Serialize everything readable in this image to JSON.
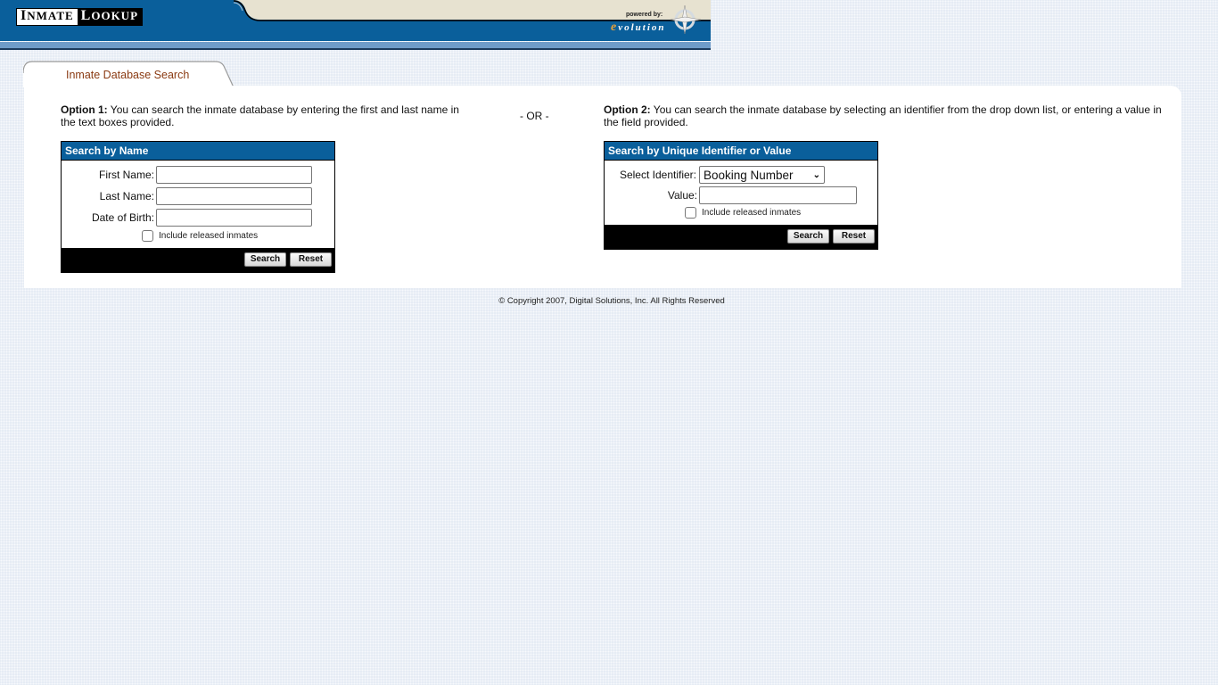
{
  "header": {
    "logo_word1_cap": "I",
    "logo_word1_rest": "NMATE",
    "logo_word2_cap": "L",
    "logo_word2_rest": "OOKUP",
    "powered_by": "powered by:",
    "brand_e": "e",
    "brand_rest": "volution",
    "colors": {
      "banner_blue": "#0a5f9b",
      "banner_beige": "#e7e2d0",
      "stripe_blue": "#6f9cc9"
    }
  },
  "tab": {
    "label": "Inmate Database Search",
    "label_color": "#8a3a12"
  },
  "option1": {
    "prefix": "Option 1:",
    "text": " You can search the inmate database by entering the first and last name in the text boxes provided."
  },
  "separator": "- OR -",
  "option2": {
    "prefix": "Option 2:",
    "text": " You can search the inmate database by selecting an identifier from the drop down list, or entering a value in the field provided."
  },
  "search_by_name": {
    "title": "Search by Name",
    "fields": [
      {
        "label": "First Name:",
        "value": "",
        "placeholder": ""
      },
      {
        "label": "Last Name:",
        "value": "",
        "placeholder": ""
      },
      {
        "label": "Date of Birth:",
        "value": "",
        "placeholder": ""
      }
    ],
    "include_released_label": "Include released inmates",
    "include_released_checked": false,
    "search_label": "Search",
    "reset_label": "Reset"
  },
  "search_by_id": {
    "title": "Search by Unique Identifier or Value",
    "identifier_label": "Select Identifier:",
    "identifier_selected": "Booking Number",
    "value_label": "Value:",
    "value": "",
    "include_released_label": "Include released inmates",
    "include_released_checked": false,
    "search_label": "Search",
    "reset_label": "Reset"
  },
  "footer": {
    "copyright": "© Copyright 2007, Digital Solutions, Inc. All Rights Reserved"
  }
}
